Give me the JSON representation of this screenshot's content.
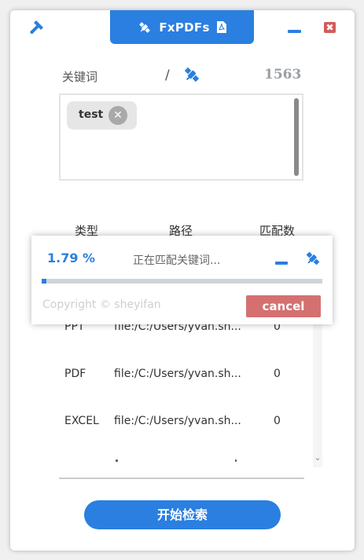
{
  "colors": {
    "accent": "#2a7fe0",
    "close": "#d35a5a",
    "cancel": "#d57070",
    "count": "#9aa0a6"
  },
  "header": {
    "title": "FxPDFs",
    "tools_icon": "hammer-icon",
    "title_icons": [
      "satellite-icon",
      "pdf-file-icon"
    ],
    "minimize_icon": "minimize-icon",
    "close_icon": "close-icon",
    "close_glyph": "✖"
  },
  "keywords": {
    "label": "关键词",
    "separator": "/",
    "action_icon": "satellite-icon",
    "count": "1563",
    "chips": [
      {
        "text": "test",
        "remove_glyph": "✕"
      }
    ]
  },
  "table": {
    "headers": [
      "类型",
      "路径",
      "匹配数"
    ],
    "rows": [
      {
        "type": "PPT",
        "path": "file:/C:/Users/yvan.sh...",
        "count": "0"
      },
      {
        "type": "PDF",
        "path": "file:/C:/Users/yvan.sh...",
        "count": "0"
      },
      {
        "type": "EXCEL",
        "path": "file:/C:/Users/yvan.sh...",
        "count": "0"
      }
    ],
    "scroll_glyph": "⌄"
  },
  "search_button": "开始检索",
  "progress_dialog": {
    "percent_text": "1.79 %",
    "progress": 0.0179,
    "status": "正在匹配关键词...",
    "minimize_icon": "minimize-icon",
    "satellite_icon": "satellite-icon",
    "copyright": "Copyright © sheyifan",
    "cancel": "cancel"
  }
}
